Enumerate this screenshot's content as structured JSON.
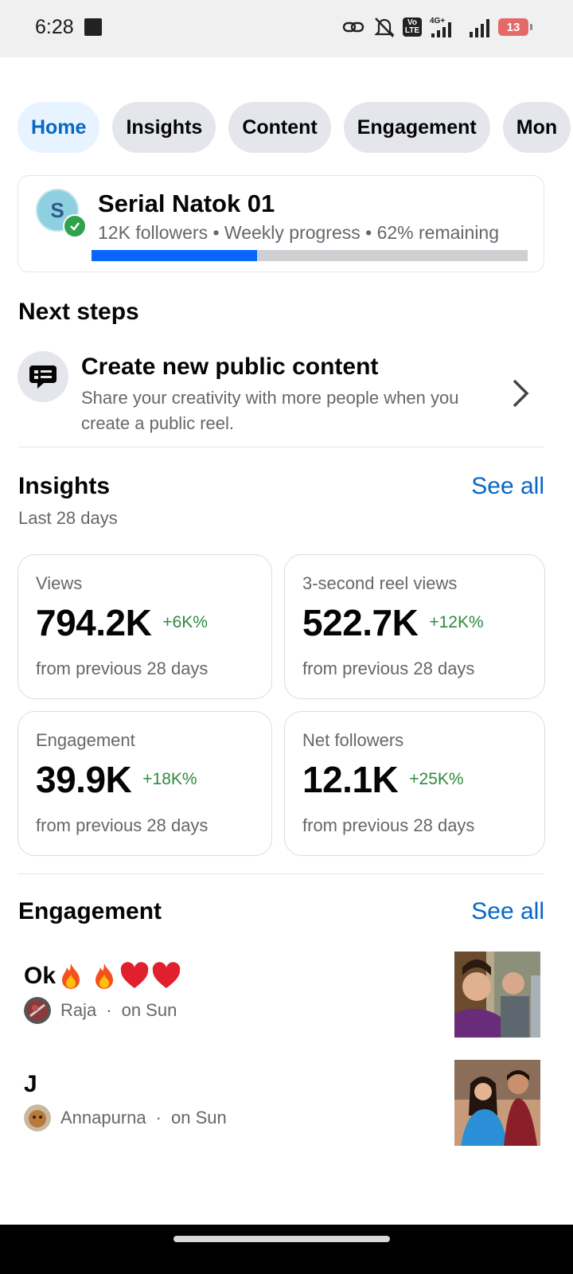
{
  "status_bar": {
    "time": "6:28",
    "battery": "13",
    "volte_label": "Vo LTE",
    "network_label": "4G+"
  },
  "tabs": [
    {
      "label": "Home",
      "active": true
    },
    {
      "label": "Insights",
      "active": false
    },
    {
      "label": "Content",
      "active": false
    },
    {
      "label": "Engagement",
      "active": false
    },
    {
      "label": "Mon",
      "active": false
    }
  ],
  "page": {
    "avatar_letter": "S",
    "name": "Serial Natok 01",
    "meta": "12K followers • Weekly progress • 62% remaining",
    "progress_fraction": 0.38
  },
  "next_steps": {
    "title": "Next steps",
    "item": {
      "title": "Create new public content",
      "description": "Share your creativity with more people when you create a public reel.",
      "icon": "message-bubble-icon"
    }
  },
  "insights": {
    "title": "Insights",
    "see_all": "See all",
    "subtitle": "Last 28 days",
    "metrics": [
      {
        "label": "Views",
        "value": "794.2K",
        "delta": "+6K%",
        "note": "from previous 28 days"
      },
      {
        "label": "3-second reel views",
        "value": "522.7K",
        "delta": "+12K%",
        "note": "from previous 28 days"
      },
      {
        "label": "Engagement",
        "value": "39.9K",
        "delta": "+18K%",
        "note": "from previous 28 days"
      },
      {
        "label": "Net followers",
        "value": "12.1K",
        "delta": "+25K%",
        "note": "from previous 28 days"
      }
    ]
  },
  "engagement": {
    "title": "Engagement",
    "see_all": "See all",
    "comments": [
      {
        "text": "Ok",
        "emojis": [
          "fire",
          "fire",
          "heart",
          "heart"
        ],
        "author": "Raja",
        "time": "on Sun"
      },
      {
        "text": "J",
        "emojis": [],
        "author": "Annapurna",
        "time": "on Sun"
      }
    ]
  },
  "colors": {
    "accent": "#0866c6",
    "progress": "#0866ff",
    "positive": "#2e8b3e",
    "verified": "#31a24c"
  }
}
